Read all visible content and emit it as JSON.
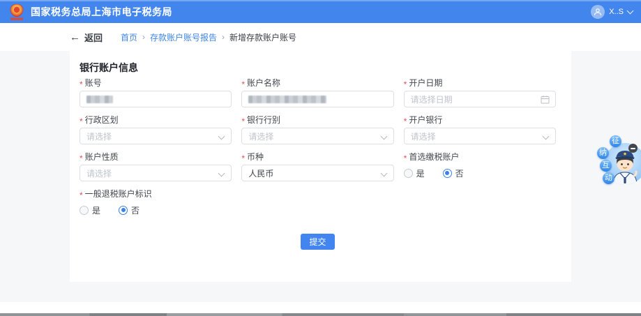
{
  "header": {
    "title": "国家税务总局上海市电子税务局",
    "user_name": "X..S"
  },
  "breadcrumb": {
    "back_label": "返回",
    "back_arrow": "←",
    "separator": "›",
    "items": [
      {
        "label": "首页"
      },
      {
        "label": "存款账户账号报告"
      },
      {
        "label": "新增存款账户账号"
      }
    ]
  },
  "form": {
    "section_title": "银行账户信息",
    "required_mark": "*",
    "account_number": {
      "label": "账号",
      "value_masked": true
    },
    "account_name": {
      "label": "账户名称",
      "value_masked": true
    },
    "open_date": {
      "label": "开户日期",
      "placeholder": "请选择日期"
    },
    "region": {
      "label": "行政区划",
      "placeholder": "请选择"
    },
    "bank_category": {
      "label": "银行行别",
      "placeholder": "请选择"
    },
    "opening_bank": {
      "label": "开户银行",
      "placeholder": "请选择"
    },
    "account_nature": {
      "label": "账户性质",
      "placeholder": "请选择"
    },
    "currency": {
      "label": "币种",
      "value": "人民币"
    },
    "preferred_tax_account": {
      "label": "首选缴税账户",
      "yes_label": "是",
      "no_label": "否",
      "selected": "否"
    },
    "general_refund_flag": {
      "label": "一般退税账户标识",
      "yes_label": "是",
      "no_label": "否",
      "selected": "否"
    },
    "submit_label": "提交"
  },
  "float_widget": {
    "badges": [
      "征",
      "纳",
      "互",
      "动"
    ]
  },
  "colors": {
    "header_blue": "#4285EC",
    "accent_blue": "#3B82E8",
    "required_red": "#E34D59",
    "page_bg": "#F6F7F9"
  }
}
